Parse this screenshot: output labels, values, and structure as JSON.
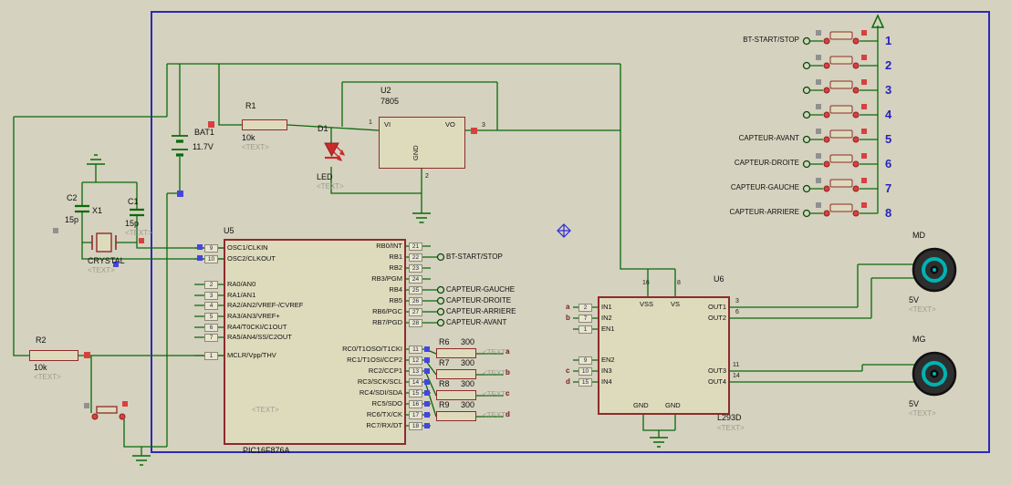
{
  "colors": {
    "background": "#d5d2bf",
    "sheet_border": "#2b2bb4",
    "wire": "#0a6a0a",
    "component_outline": "#8e2b2b",
    "component_fill": "#dedbbd",
    "gray_text": "#9c9c8e",
    "blue_number": "#2424bc",
    "red_pin": "#d84040",
    "blue_pin": "#4444e0",
    "gray_pin": "#909090",
    "motor_teal": "#00b2b2"
  },
  "parts": {
    "bat1": {
      "ref": "BAT1",
      "value": "11.7V"
    },
    "r1": {
      "ref": "R1",
      "value": "10k",
      "text": "<TEXT>"
    },
    "r2": {
      "ref": "R2",
      "value": "10k",
      "text": "<TEXT>"
    },
    "d1": {
      "ref": "D1",
      "value": "LED",
      "text": "<TEXT>"
    },
    "u2": {
      "ref": "U2",
      "value": "7805",
      "pin_vi": "VI",
      "pin_vo": "VO",
      "pin_gnd": "GND",
      "num_vi": "1",
      "num_vo": "3",
      "num_gnd": "2"
    },
    "x1": {
      "ref": "X1",
      "value": "CRYSTAL",
      "text": "<TEXT>"
    },
    "c1": {
      "ref": "C1",
      "value": "15p",
      "text": "<TEXT>"
    },
    "c2": {
      "ref": "C2",
      "value": "15p"
    },
    "u5": {
      "ref": "U5",
      "value": "PIC16F876A",
      "text": "<TEXT>"
    },
    "u6": {
      "ref": "U6",
      "value": "L293D",
      "text": "<TEXT>"
    },
    "r6": {
      "ref": "R6",
      "value": "300",
      "text": "<TEXT>",
      "net": "a"
    },
    "r7": {
      "ref": "R7",
      "value": "300",
      "text": "<TEXT>",
      "net": "b"
    },
    "r8": {
      "ref": "R8",
      "value": "300",
      "text": "<TEXT>",
      "net": "c"
    },
    "r9": {
      "ref": "R9",
      "value": "300",
      "text": "<TEXT>",
      "net": "d"
    },
    "md": {
      "ref": "MD",
      "value": "5V",
      "text": "<TEXT>"
    },
    "mg": {
      "ref": "MG",
      "value": "5V",
      "text": "<TEXT>"
    }
  },
  "u5_pins": {
    "left": [
      {
        "num": "9",
        "name": "OSC1/CLKIN"
      },
      {
        "num": "10",
        "name": "OSC2/CLKOUT"
      },
      {
        "num": "2",
        "name": "RA0/AN0"
      },
      {
        "num": "3",
        "name": "RA1/AN1"
      },
      {
        "num": "4",
        "name": "RA2/AN2/VREF-/CVREF"
      },
      {
        "num": "5",
        "name": "RA3/AN3/VREF+"
      },
      {
        "num": "6",
        "name": "RA4/T0CKI/C1OUT"
      },
      {
        "num": "7",
        "name": "RA5/AN4/SS/C2OUT"
      },
      {
        "num": "1",
        "name": "MCLR/Vpp/THV"
      }
    ],
    "right": [
      {
        "num": "21",
        "name": "RB0/INT"
      },
      {
        "num": "22",
        "name": "RB1"
      },
      {
        "num": "23",
        "name": "RB2"
      },
      {
        "num": "24",
        "name": "RB3/PGM"
      },
      {
        "num": "25",
        "name": "RB4"
      },
      {
        "num": "26",
        "name": "RB5"
      },
      {
        "num": "27",
        "name": "RB6/PGC"
      },
      {
        "num": "28",
        "name": "RB7/PGD"
      },
      {
        "num": "11",
        "name": "RC0/T1OSO/T1CKI"
      },
      {
        "num": "12",
        "name": "RC1/T1OSI/CCP2"
      },
      {
        "num": "13",
        "name": "RC2/CCP1"
      },
      {
        "num": "14",
        "name": "RC3/SCK/SCL"
      },
      {
        "num": "15",
        "name": "RC4/SDI/SDA"
      },
      {
        "num": "16",
        "name": "RC5/SDO"
      },
      {
        "num": "17",
        "name": "RC6/TX/CK"
      },
      {
        "num": "18",
        "name": "RC7/RX/DT"
      }
    ]
  },
  "u6_pins": {
    "left": [
      {
        "num": "2",
        "name": "IN1",
        "net": "a"
      },
      {
        "num": "7",
        "name": "IN2",
        "net": "b"
      },
      {
        "num": "1",
        "name": "EN1",
        "net": ""
      },
      {
        "num": "9",
        "name": "EN2",
        "net": ""
      },
      {
        "num": "10",
        "name": "IN3",
        "net": "c"
      },
      {
        "num": "15",
        "name": "IN4",
        "net": "d"
      }
    ],
    "top": [
      {
        "num": "16",
        "name": "VSS"
      },
      {
        "num": "8",
        "name": "VS"
      }
    ],
    "right": [
      {
        "num": "3",
        "name": "OUT1"
      },
      {
        "num": "6",
        "name": "OUT2"
      },
      {
        "num": "11",
        "name": "OUT3"
      },
      {
        "num": "14",
        "name": "OUT4"
      }
    ],
    "bottom": [
      "GND",
      "GND"
    ]
  },
  "net_labels": {
    "bt": "BT-START/STOP",
    "gauche": "CAPTEUR-GAUCHE",
    "droite": "CAPTEUR-DROITE",
    "arriere": "CAPTEUR-ARRIERE",
    "avant": "CAPTEUR-AVANT"
  },
  "switch_panel": {
    "rows": [
      {
        "label": "BT-START/STOP",
        "num": "1"
      },
      {
        "label": "",
        "num": "2"
      },
      {
        "label": "",
        "num": "3"
      },
      {
        "label": "",
        "num": "4"
      },
      {
        "label": "CAPTEUR-AVANT",
        "num": "5"
      },
      {
        "label": "CAPTEUR-DROITE",
        "num": "6"
      },
      {
        "label": "CAPTEUR-GAUCHE",
        "num": "7"
      },
      {
        "label": "CAPTEUR-ARRIERE",
        "num": "8"
      }
    ]
  }
}
